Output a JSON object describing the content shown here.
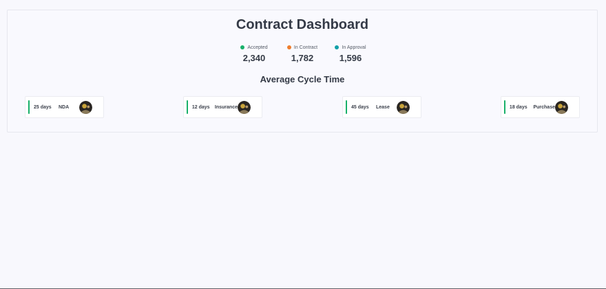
{
  "dashboard": {
    "title": "Contract Dashboard",
    "stats": [
      {
        "label": "Accepted",
        "value": "2,340",
        "color": "#18b06a"
      },
      {
        "label": "In Contract",
        "value": "1,782",
        "color": "#ef7d2d"
      },
      {
        "label": "In Approval",
        "value": "1,596",
        "color": "#12a0a8"
      }
    ],
    "cycle_title": "Average Cycle Time",
    "cycle_cards": [
      {
        "days": "25 days",
        "type": "NDA"
      },
      {
        "days": "12 days",
        "type": "Insurance"
      },
      {
        "days": "45 days",
        "type": "Lease"
      },
      {
        "days": "18 days",
        "type": "Purchase"
      }
    ],
    "accent_color": "#18b06a"
  }
}
